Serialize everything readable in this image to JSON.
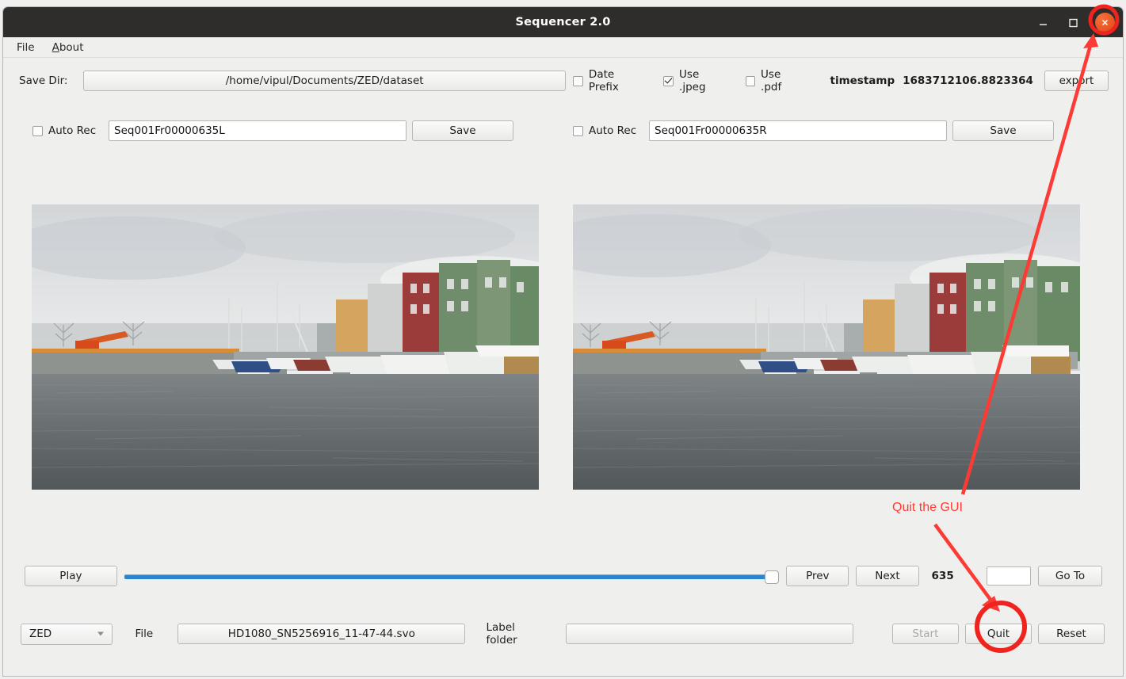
{
  "window": {
    "title": "Sequencer 2.0",
    "minimize_icon": "minimize-icon",
    "maximize_icon": "maximize-icon",
    "close_icon": "close-icon",
    "titlebar_color": "#2f2d2c",
    "close_button_color": "#e8521f"
  },
  "menubar": {
    "items": [
      {
        "label": "File",
        "accelerator": ""
      },
      {
        "label": "About",
        "accelerator": "A"
      }
    ]
  },
  "save_dir_row": {
    "label": "Save Dir:",
    "path": "/home/vipul/Documents/ZED/dataset",
    "checkboxes": [
      {
        "label": "Date Prefix",
        "checked": false
      },
      {
        "label": "Use .jpeg",
        "checked": true
      },
      {
        "label": "Use .pdf",
        "checked": false
      }
    ],
    "timestamp_label": "timestamp",
    "timestamp_value": "1683712106.8823364",
    "export_label": "export"
  },
  "record_rows": [
    {
      "checkbox_label": "Auto Rec",
      "checked": false,
      "filename": "Seq001Fr00000635L",
      "save_label": "Save"
    },
    {
      "checkbox_label": "Auto Rec",
      "checked": false,
      "filename": "Seq001Fr00000635R",
      "save_label": "Save"
    }
  ],
  "preview": {
    "left_name": "left-camera-preview",
    "right_name": "right-camera-preview",
    "scene": "harbour waterfront with moored boats, bridge and colourful quayside buildings"
  },
  "transport": {
    "play_label": "Play",
    "slider_value": 100,
    "slider_min": 0,
    "slider_max": 100,
    "prev_label": "Prev",
    "next_label": "Next",
    "frame_number": "635",
    "goto_value": "",
    "goto_label": "Go To"
  },
  "bottom": {
    "camera_selected": "ZED",
    "camera_options": [
      "ZED"
    ],
    "file_label": "File",
    "file_value": "HD1080_SN5256916_11-47-44.svo",
    "label_folder_label": "Label folder",
    "label_folder_value": "",
    "start_label": "Start",
    "start_disabled": true,
    "quit_label": "Quit",
    "reset_label": "Reset"
  },
  "annotation": {
    "text": "Quit the GUI",
    "color": "#ff3b30"
  }
}
